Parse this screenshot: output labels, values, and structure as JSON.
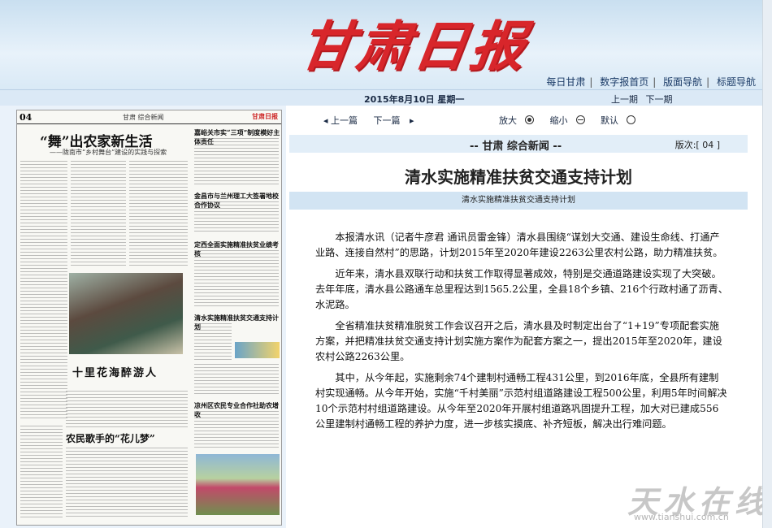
{
  "masthead": "甘肃日报",
  "top_nav": [
    "每日甘肃",
    "数字报首页",
    "版面导航",
    "标题导航"
  ],
  "date_line": "2015年8月10日  星期一",
  "page_nav": {
    "prev_page": "上一期",
    "next_page": "下一期"
  },
  "article_nav": {
    "prev_article": "上一篇",
    "next_article": "下一篇",
    "zoom_in": "放大",
    "zoom_out": "缩小",
    "default": "默认"
  },
  "section": {
    "title": "-- 甘肃 综合新闻 --",
    "page_label": "版次:[ 04 ]"
  },
  "article": {
    "title": "清水实施精准扶贫交通支持计划",
    "subtitle": "清水实施精准扶贫交通支持计划",
    "paragraphs": [
      "本报清水讯（记者牛彦君 通讯员雷金锋）清水县围绕“谋划大交通、建设生命线、打通产业路、连接自然村”的思路，计划2015年至2020年建设2263公里农村公路，助力精准扶贫。",
      "近年来，清水县双联行动和扶贫工作取得显著成效，特别是交通道路建设实现了大突破。去年年底，清水县公路通车总里程达到1565.2公里，全县18个乡镇、216个行政村通了沥青、水泥路。",
      "全省精准扶贫精准脱贫工作会议召开之后，清水县及时制定出台了“1+19”专项配套实施方案，并把精准扶贫交通支持计划实施方案作为配套方案之一，提出2015年至2020年，建设农村公路2263公里。",
      "其中，从今年起，实施剩余74个建制村通畅工程431公里，到2016年底，全县所有建制村实现通畅。从今年开始，实施“千村美丽”示范村组道路建设工程500公里，利用5年时间解决10个示范村村组道路建设。从今年至2020年开展村组道路巩固提升工程，加大对已建成556公里建制村通畅工程的养护力度，进一步核实摸底、补齐短板，解决出行难问题。"
    ]
  },
  "newspaper_thumb": {
    "page_no": "04",
    "section": "甘肃 综合新闻",
    "logo": "甘肃日报",
    "headline": "“舞”出农家新生活",
    "subhead": "——陇南市“乡村舞台”建设的实践与探索",
    "side_heads": [
      "嘉峪关市实“三项”制度模好主体责任",
      "金昌市与兰州理工大签署地校合作协议",
      "定西全面实施精准扶贫业绩考核",
      "清水实施精准扶贫交通支持计划",
      "凉州区农民专业合作社助农增收"
    ],
    "mid_head": "十里花海醉游人",
    "low_head": "农民歌手的“花儿梦”"
  },
  "watermark": {
    "text": "天水在线",
    "url": "www.tianshui.com.cn"
  }
}
